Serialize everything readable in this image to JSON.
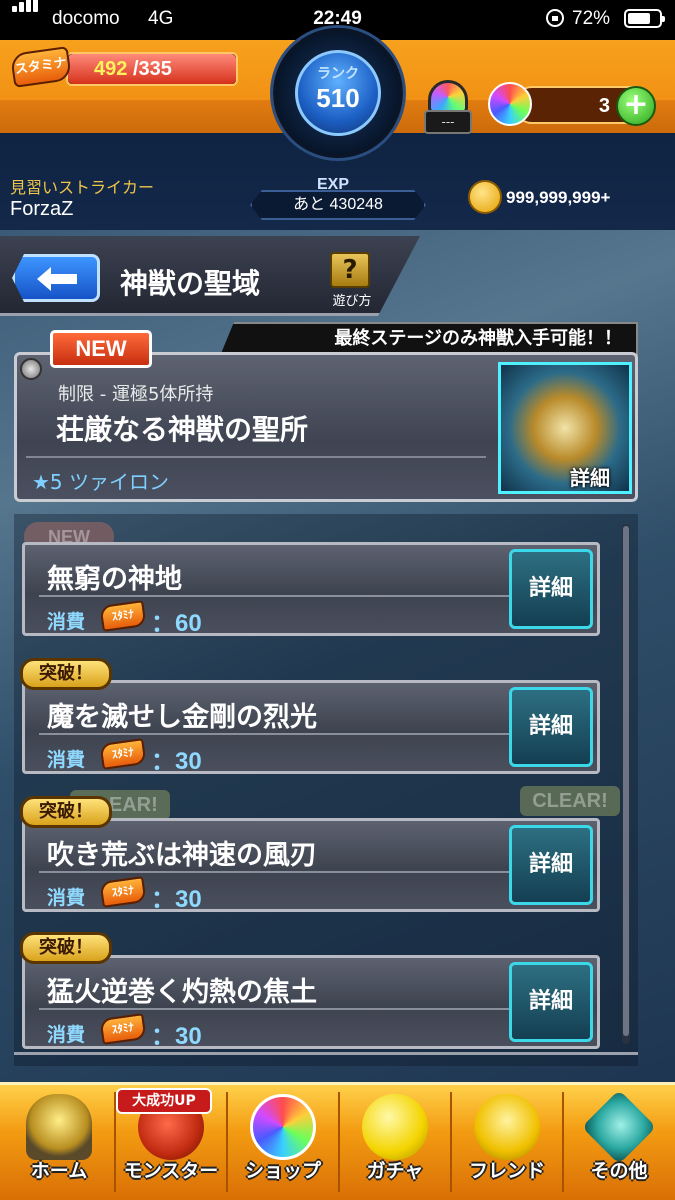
{
  "status_bar": {
    "carrier": "docomo",
    "network": "4G",
    "time": "22:49",
    "battery": "72%",
    "battery_level": 0.72
  },
  "header": {
    "stamina_icon_label": "スタミナ",
    "stamina_current": "492",
    "stamina_max": "/335",
    "stamina_fill": 1.0,
    "rank_label": "ランク",
    "rank_value": "510",
    "exp_label": "EXP",
    "exp_remaining": "あと 430248",
    "helmet_plate": "---",
    "orb_count": "3",
    "plus_label": "+",
    "player_title": "見習いストライカー",
    "player_name": "ForzaZ",
    "coins": "999,999,999+"
  },
  "titlebar": {
    "title": "神獣の聖域",
    "howto_icon": "?",
    "howto_label": "遊び方"
  },
  "featured": {
    "new_badge": "NEW",
    "notice": "最終ステージのみ神獣入手可能！！",
    "restriction": "制限 - 運極5体所持",
    "name": "荘厳なる神獣の聖所",
    "star_label": "★5 ツァイロン",
    "detail_label": "詳細"
  },
  "ghost_labels": {
    "new": "NEW",
    "clear": "CLEAR!"
  },
  "stages": [
    {
      "tag": "",
      "name": "無窮の神地",
      "cost_label": "消費",
      "cost_icon": "ｽﾀﾐﾅ",
      "cost_value": "：60",
      "detail": "詳細"
    },
    {
      "tag": "突破！",
      "name": "魔を滅せし金剛の烈光",
      "cost_label": "消費",
      "cost_icon": "ｽﾀﾐﾅ",
      "cost_value": "：30",
      "detail": "詳細"
    },
    {
      "tag": "突破！",
      "name": "吹き荒ぶは神速の風刃",
      "cost_label": "消費",
      "cost_icon": "ｽﾀﾐﾅ",
      "cost_value": "：30",
      "detail": "詳細"
    },
    {
      "tag": "突破！",
      "name": "猛火逆巻く灼熱の焦土",
      "cost_label": "消費",
      "cost_icon": "ｽﾀﾐﾅ",
      "cost_value": "：30",
      "detail": "詳細"
    }
  ],
  "bottom_nav": {
    "home": "ホーム",
    "monster": "モンスター",
    "monster_badge": "大成功UP",
    "shop": "ショップ",
    "gacha": "ガチャ",
    "friend": "フレンド",
    "other": "その他"
  }
}
